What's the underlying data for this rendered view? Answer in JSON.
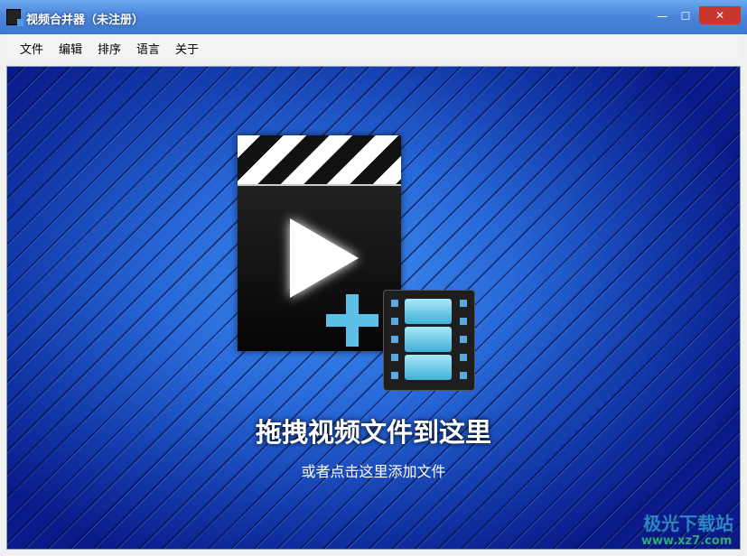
{
  "window": {
    "title": "视频合并器（未注册）",
    "minimize": "—",
    "maximize": "☐",
    "close": "✕"
  },
  "menu": [
    "文件",
    "编辑",
    "排序",
    "语言",
    "关于"
  ],
  "main": {
    "drag_text": "拖拽视频文件到这里",
    "click_text": "或者点击这里添加文件"
  },
  "watermark": {
    "name": "极光下载站",
    "url": "www.xz7.com"
  }
}
